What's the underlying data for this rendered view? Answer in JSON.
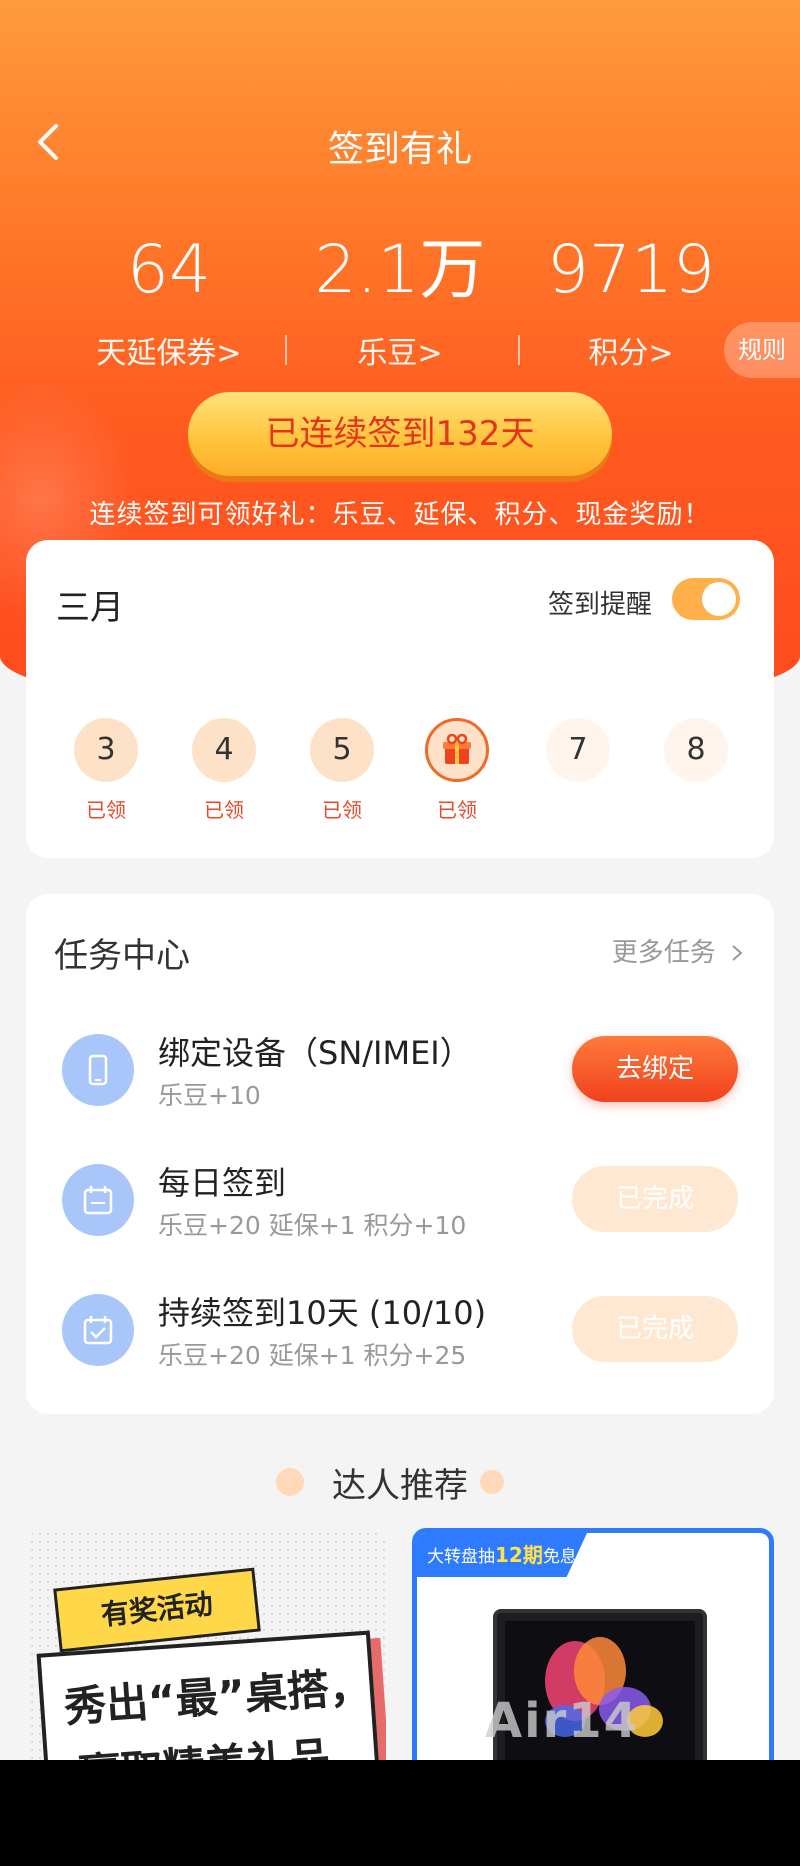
{
  "header": {
    "title": "签到有礼"
  },
  "stats": [
    {
      "value": "64",
      "label": "天延保券>"
    },
    {
      "value": "2.1万",
      "label": "乐豆>"
    },
    {
      "value": "9719",
      "label": "积分>"
    }
  ],
  "rules_label": "规则",
  "checkin": {
    "streak_label": "已连续签到132天",
    "tagline": "连续签到可领好礼：乐豆、延保、积分、现金奖励！"
  },
  "calendar": {
    "month": "三月",
    "reminder_label": "签到提醒",
    "reminder_on": true,
    "days": [
      {
        "label": "3",
        "status": "已领"
      },
      {
        "label": "4",
        "status": "已领"
      },
      {
        "label": "5",
        "status": "已领"
      },
      {
        "label": "",
        "status": "已领",
        "icon": "gift-icon"
      },
      {
        "label": "7",
        "status": ""
      },
      {
        "label": "8",
        "status": ""
      }
    ]
  },
  "tasks": {
    "title": "任务中心",
    "more_label": "更多任务",
    "items": [
      {
        "icon": "phone-icon",
        "name": "绑定设备（SN/IMEI）",
        "reward": "乐豆+10",
        "button": "去绑定",
        "state": "pending"
      },
      {
        "icon": "calendar-sign-icon",
        "name": "每日签到",
        "reward": "乐豆+20 延保+1 积分+10",
        "button": "已完成",
        "state": "done"
      },
      {
        "icon": "calendar-check-icon",
        "name": "持续签到10天 (10/10)",
        "reward": "乐豆+20 延保+1 积分+25",
        "button": "已完成",
        "state": "done"
      }
    ]
  },
  "recommend": {
    "title": "达人推荐",
    "promo1": {
      "tag": "有奖活动",
      "line1": "秀出“最”桌搭，",
      "line2": "赢取精美礼品"
    },
    "promo2": {
      "badge_pre": "大转盘抽",
      "badge_hl": "12期",
      "badge_post": "免息",
      "watermark": "Air14"
    }
  },
  "colors": {
    "accent": "#ff5a20",
    "gold": "#ffc23a",
    "done_button": "#ffe8d2"
  }
}
